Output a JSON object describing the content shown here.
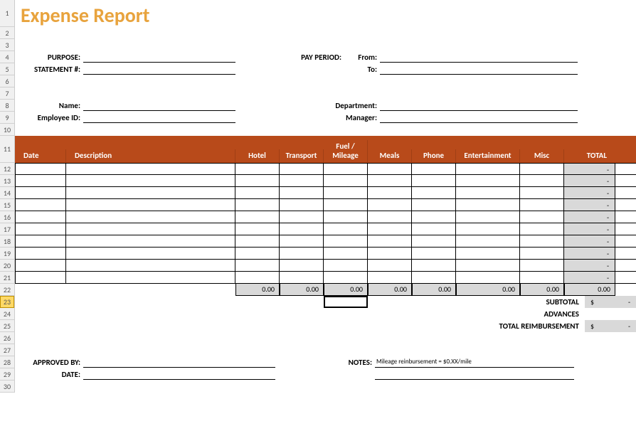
{
  "title": "Expense Report",
  "fields": {
    "purpose": "PURPOSE:",
    "statement": "STATEMENT #:",
    "payperiod": "PAY PERIOD:",
    "from": "From:",
    "to": "To:",
    "name": "Name:",
    "employeeid": "Employee ID:",
    "department": "Department:",
    "manager": "Manager:",
    "approvedby": "APPROVED BY:",
    "date": "DATE:",
    "notes": "NOTES:"
  },
  "headers": {
    "date": "Date",
    "description": "Description",
    "hotel": "Hotel",
    "transport": "Transport",
    "fuel": "Fuel / Mileage",
    "meals": "Meals",
    "phone": "Phone",
    "entertainment": "Entertainment",
    "misc": "Misc",
    "total": "TOTAL"
  },
  "rowdash": "-",
  "sums": {
    "hotel": "0.00",
    "transport": "0.00",
    "fuel": "0.00",
    "meals": "0.00",
    "phone": "0.00",
    "entertainment": "0.00",
    "misc": "0.00",
    "total": "0.00"
  },
  "totals": {
    "subtotal_label": "SUBTOTAL",
    "advances_label": "ADVANCES",
    "reimb_label": "TOTAL REIMBURSEMENT",
    "currency": "$",
    "dash": "-"
  },
  "note_text": "Mileage reinbursement = $0.XX/mile",
  "rownums": [
    "1",
    "2",
    "3",
    "4",
    "5",
    "6",
    "7",
    "8",
    "9",
    "10",
    "11",
    "12",
    "13",
    "14",
    "15",
    "16",
    "17",
    "18",
    "19",
    "20",
    "21",
    "22",
    "23",
    "24",
    "25",
    "26",
    "27",
    "28",
    "29",
    "30"
  ]
}
